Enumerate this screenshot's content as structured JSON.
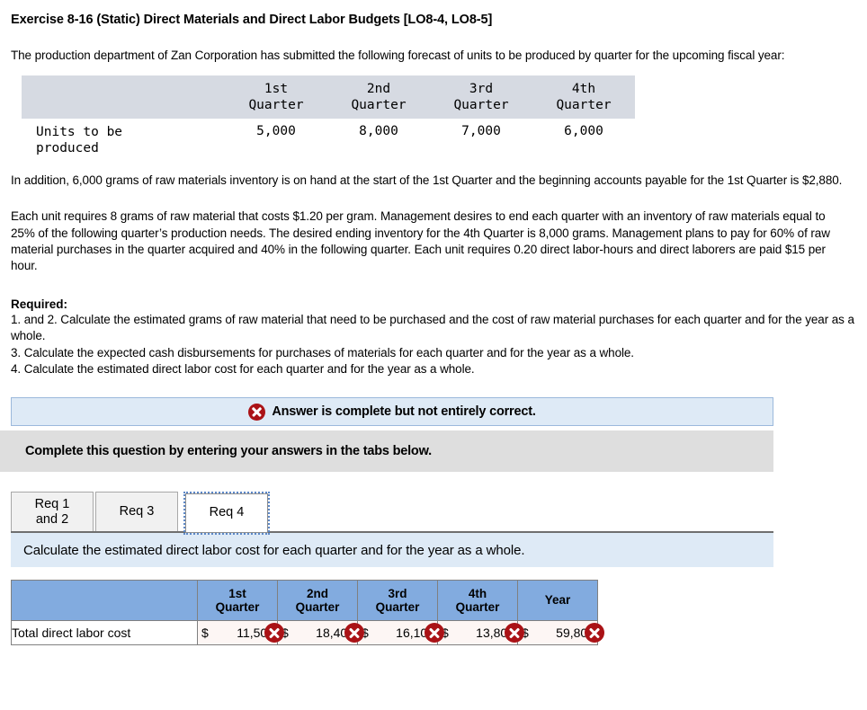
{
  "title": "Exercise 8-16 (Static) Direct Materials and Direct Labor Budgets [LO8-4, LO8-5]",
  "intro": "The production department of Zan Corporation has submitted the following forecast of units to be produced by quarter for the upcoming fiscal year:",
  "given_table": {
    "row_label_line1": "Units to be",
    "row_label_line2": "produced",
    "columns": [
      {
        "line1": "1st",
        "line2": "Quarter"
      },
      {
        "line1": "2nd",
        "line2": "Quarter"
      },
      {
        "line1": "3rd",
        "line2": "Quarter"
      },
      {
        "line1": "4th",
        "line2": "Quarter"
      }
    ],
    "values": [
      "5,000",
      "8,000",
      "7,000",
      "6,000"
    ]
  },
  "paragraphs": {
    "p1": "In addition, 6,000 grams of raw materials inventory is on hand at the start of the 1st Quarter and the beginning accounts payable for the 1st Quarter is $2,880.",
    "p2": "Each unit requires 8 grams of raw material that costs $1.20 per gram. Management desires to end each quarter with an inventory of raw materials equal to 25% of the following quarter’s production needs. The desired ending inventory for the 4th Quarter is 8,000 grams. Management plans to pay for 60% of raw material purchases in the quarter acquired and 40% in the following quarter. Each unit requires 0.20 direct labor-hours and direct laborers are paid $15 per hour."
  },
  "required": {
    "heading": "Required:",
    "items": [
      "1. and 2. Calculate the estimated grams of raw material that need to be purchased and the cost of raw material purchases for each quarter and for the year as a whole.",
      "3. Calculate the expected cash disbursements for purchases of materials for each quarter and for the year as a whole.",
      "4. Calculate the estimated direct labor cost for each quarter and for the year as a whole."
    ]
  },
  "status_banner": {
    "icon": "error-x-icon",
    "text": "Answer is complete but not entirely correct."
  },
  "gray_band": {
    "text": "Complete this question by entering your answers in the tabs below."
  },
  "tabs": [
    {
      "id": "req-1-and-2",
      "label_line1": "Req 1",
      "label_line2": "and 2",
      "selected": false
    },
    {
      "id": "req-3",
      "label_line1": "Req 3",
      "label_line2": "",
      "selected": false
    },
    {
      "id": "req-4",
      "label_line1": "Req 4",
      "label_line2": "",
      "selected": true
    }
  ],
  "sub_instruction": "Calculate the estimated direct labor cost for each quarter and for the year as a whole.",
  "answer_table": {
    "label_header": "",
    "columns": [
      {
        "line1": "1st",
        "line2": "Quarter"
      },
      {
        "line1": "2nd",
        "line2": "Quarter"
      },
      {
        "line1": "3rd",
        "line2": "Quarter"
      },
      {
        "line1": "4th",
        "line2": "Quarter"
      },
      {
        "line1": "Year",
        "line2": ""
      }
    ],
    "row_label": "Total direct labor cost",
    "currency": "$",
    "values": [
      "11,500",
      "18,400",
      "16,100",
      "13,800",
      "59,800"
    ],
    "marks": [
      "incorrect",
      "incorrect",
      "incorrect",
      "incorrect",
      "incorrect"
    ]
  },
  "colors": {
    "given_header_bg": "#d6dae2",
    "answer_header_bg": "#82abdf",
    "banner_bg": "#deeaf6",
    "banner_border": "#9cb9dc",
    "gray_band_bg": "#dedede",
    "error_red": "#aa1216",
    "value_cell_bg": "#fdf6f4"
  }
}
